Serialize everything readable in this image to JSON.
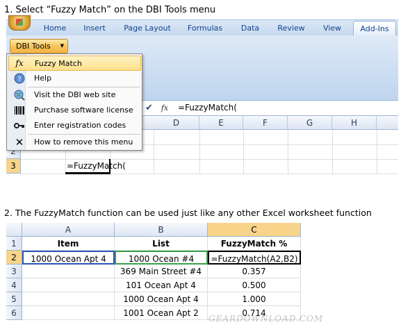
{
  "step1": {
    "caption": "1.  Select “Fuzzy Match” on the DBI Tools menu"
  },
  "ribbon": {
    "tabs": [
      {
        "label": "Home"
      },
      {
        "label": "Insert"
      },
      {
        "label": "Page Layout"
      },
      {
        "label": "Formulas"
      },
      {
        "label": "Data"
      },
      {
        "label": "Review"
      },
      {
        "label": "View"
      },
      {
        "label": "Add-Ins",
        "active": true
      }
    ],
    "dbi_button_label": "DBI Tools",
    "accent_color": "#f8c45b"
  },
  "menu": {
    "items": [
      {
        "label": "Fuzzy Match",
        "icon": "fx-icon",
        "highlighted": true
      },
      {
        "label": "Help",
        "icon": "help-icon"
      },
      {
        "label": "Visit the DBI web site",
        "icon": "web-globe-icon"
      },
      {
        "label": "Purchase software license",
        "icon": "barcode-icon"
      },
      {
        "label": "Enter registration codes",
        "icon": "key-icon"
      },
      {
        "label": "How to remove this menu",
        "icon": "close-x-icon"
      }
    ]
  },
  "sheet1": {
    "formula_bar_text": "=FuzzyMatch(",
    "fx_label": "fx",
    "columns": [
      "D",
      "E",
      "F",
      "G",
      "H"
    ],
    "rows": [
      "2",
      "3"
    ],
    "active_row": "3",
    "active_cell_text": "=FuzzyMatch("
  },
  "step2": {
    "caption": "2. The FuzzyMatch function can be used just like any other Excel worksheet function"
  },
  "sheet2": {
    "columns": [
      "A",
      "B",
      "C"
    ],
    "active_column": "C",
    "active_row": "2",
    "rows": [
      {
        "num": "1",
        "a": "Item",
        "b": "List",
        "c": "FuzzyMatch %"
      },
      {
        "num": "2",
        "a": "1000 Ocean Apt 4",
        "b": "1000 Ocean #4",
        "c": "=FuzzyMatch(A2,B2)"
      },
      {
        "num": "3",
        "a": "",
        "b": "369 Main Street #4",
        "c": "0.357"
      },
      {
        "num": "4",
        "a": "",
        "b": "101 Ocean Apt 4",
        "c": "0.500"
      },
      {
        "num": "5",
        "a": "",
        "b": "1000 Ocean Apt 4",
        "c": "1.000"
      },
      {
        "num": "6",
        "a": "",
        "b": "1001 Ocean Apt 2",
        "c": "0.714"
      }
    ]
  },
  "watermark": "GEARDOWNLOAD.COM"
}
